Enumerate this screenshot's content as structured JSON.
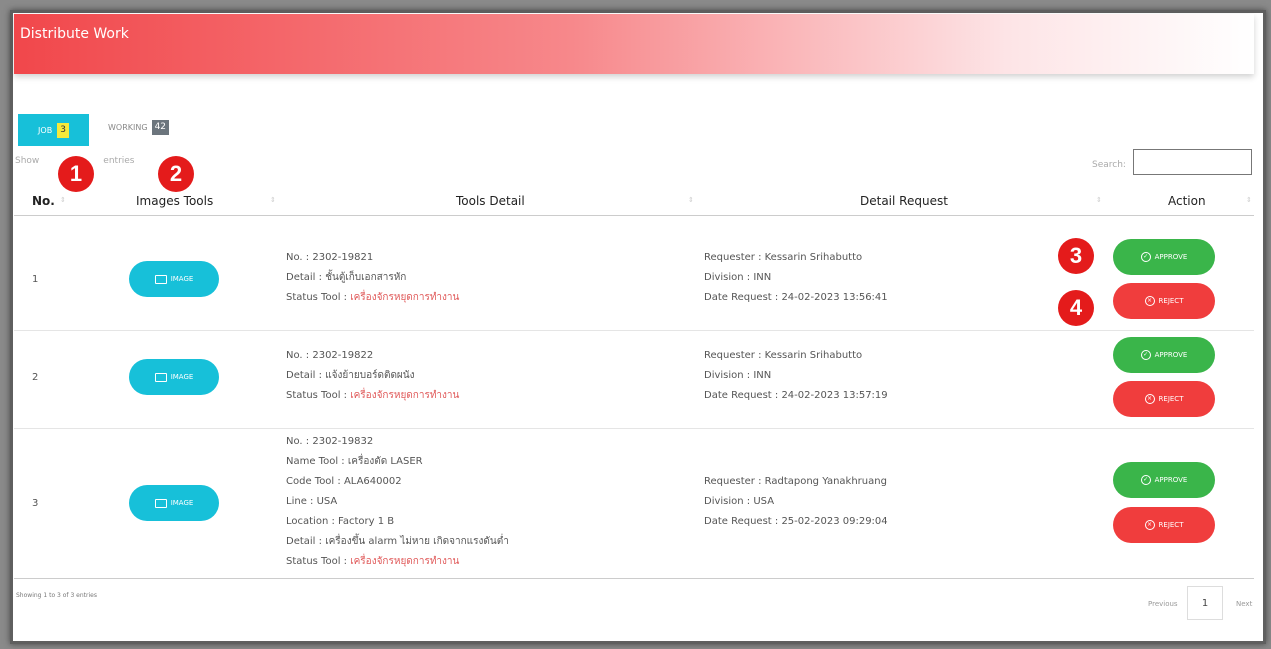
{
  "header": {
    "title": "Distribute Work"
  },
  "tabs": {
    "job": {
      "label": "JOB",
      "count": "3"
    },
    "working": {
      "label": "WORKING",
      "count": "42"
    }
  },
  "markers": [
    "1",
    "2",
    "3",
    "4"
  ],
  "show_entries": {
    "prefix": "Show",
    "suffix": "entries"
  },
  "search": {
    "label": "Search:",
    "value": ""
  },
  "columns": [
    "No.",
    "Images Tools",
    "Tools Detail",
    "Detail Request",
    "Action"
  ],
  "rows": [
    {
      "no": "1",
      "image_label": "IMAGE",
      "tools_detail": [
        {
          "label": "No.",
          "value": "2302-19821"
        },
        {
          "label": "Detail",
          "value": "ชั้นตู้เก็บเอกสารหัก"
        },
        {
          "label": "Status Tool",
          "value": "เครื่องจักรหยุดการทำงาน"
        }
      ],
      "request": [
        {
          "label": "Requester",
          "value": "Kessarin Srihabutto"
        },
        {
          "label": "Division",
          "value": "INN"
        },
        {
          "label": "Date Request",
          "value": "24-02-2023 13:56:41"
        }
      ],
      "approve": "APPROVE",
      "reject": "REJECT"
    },
    {
      "no": "2",
      "image_label": "IMAGE",
      "tools_detail": [
        {
          "label": "No.",
          "value": "2302-19822"
        },
        {
          "label": "Detail",
          "value": "แจ้งย้ายบอร์ดติดผนัง"
        },
        {
          "label": "Status Tool",
          "value": "เครื่องจักรหยุดการทำงาน"
        }
      ],
      "request": [
        {
          "label": "Requester",
          "value": "Kessarin Srihabutto"
        },
        {
          "label": "Division",
          "value": "INN"
        },
        {
          "label": "Date Request",
          "value": "24-02-2023 13:57:19"
        }
      ],
      "approve": "APPROVE",
      "reject": "REJECT"
    },
    {
      "no": "3",
      "image_label": "IMAGE",
      "tools_detail": [
        {
          "label": "No.",
          "value": "2302-19832"
        },
        {
          "label": "Name Tool",
          "value": "เครื่องตัด LASER"
        },
        {
          "label": "Code Tool",
          "value": "ALA640002"
        },
        {
          "label": "Line",
          "value": "USA"
        },
        {
          "label": "Location",
          "value": "Factory 1 B"
        },
        {
          "label": "Detail",
          "value": "เครื่องขึ้น alarm ไม่หาย เกิดจากแรงดันต่ำ"
        },
        {
          "label": "Status Tool",
          "value": "เครื่องจักรหยุดการทำงาน"
        }
      ],
      "request": [
        {
          "label": "Requester",
          "value": "Radtapong Yanakhruang"
        },
        {
          "label": "Division",
          "value": "USA"
        },
        {
          "label": "Date Request",
          "value": "25-02-2023 09:29:04"
        }
      ],
      "approve": "APPROVE",
      "reject": "REJECT"
    }
  ],
  "footer": {
    "info": "Showing 1 to 3 of 3 entries",
    "previous": "Previous",
    "page": "1",
    "next": "Next"
  },
  "colors": {
    "header_red": "#f1474b",
    "cyan": "#17c0d9",
    "approve_green": "#3ab54a",
    "reject_red": "#f03d3d",
    "marker_red": "#e41b1b",
    "status_red": "#e05a5a"
  }
}
